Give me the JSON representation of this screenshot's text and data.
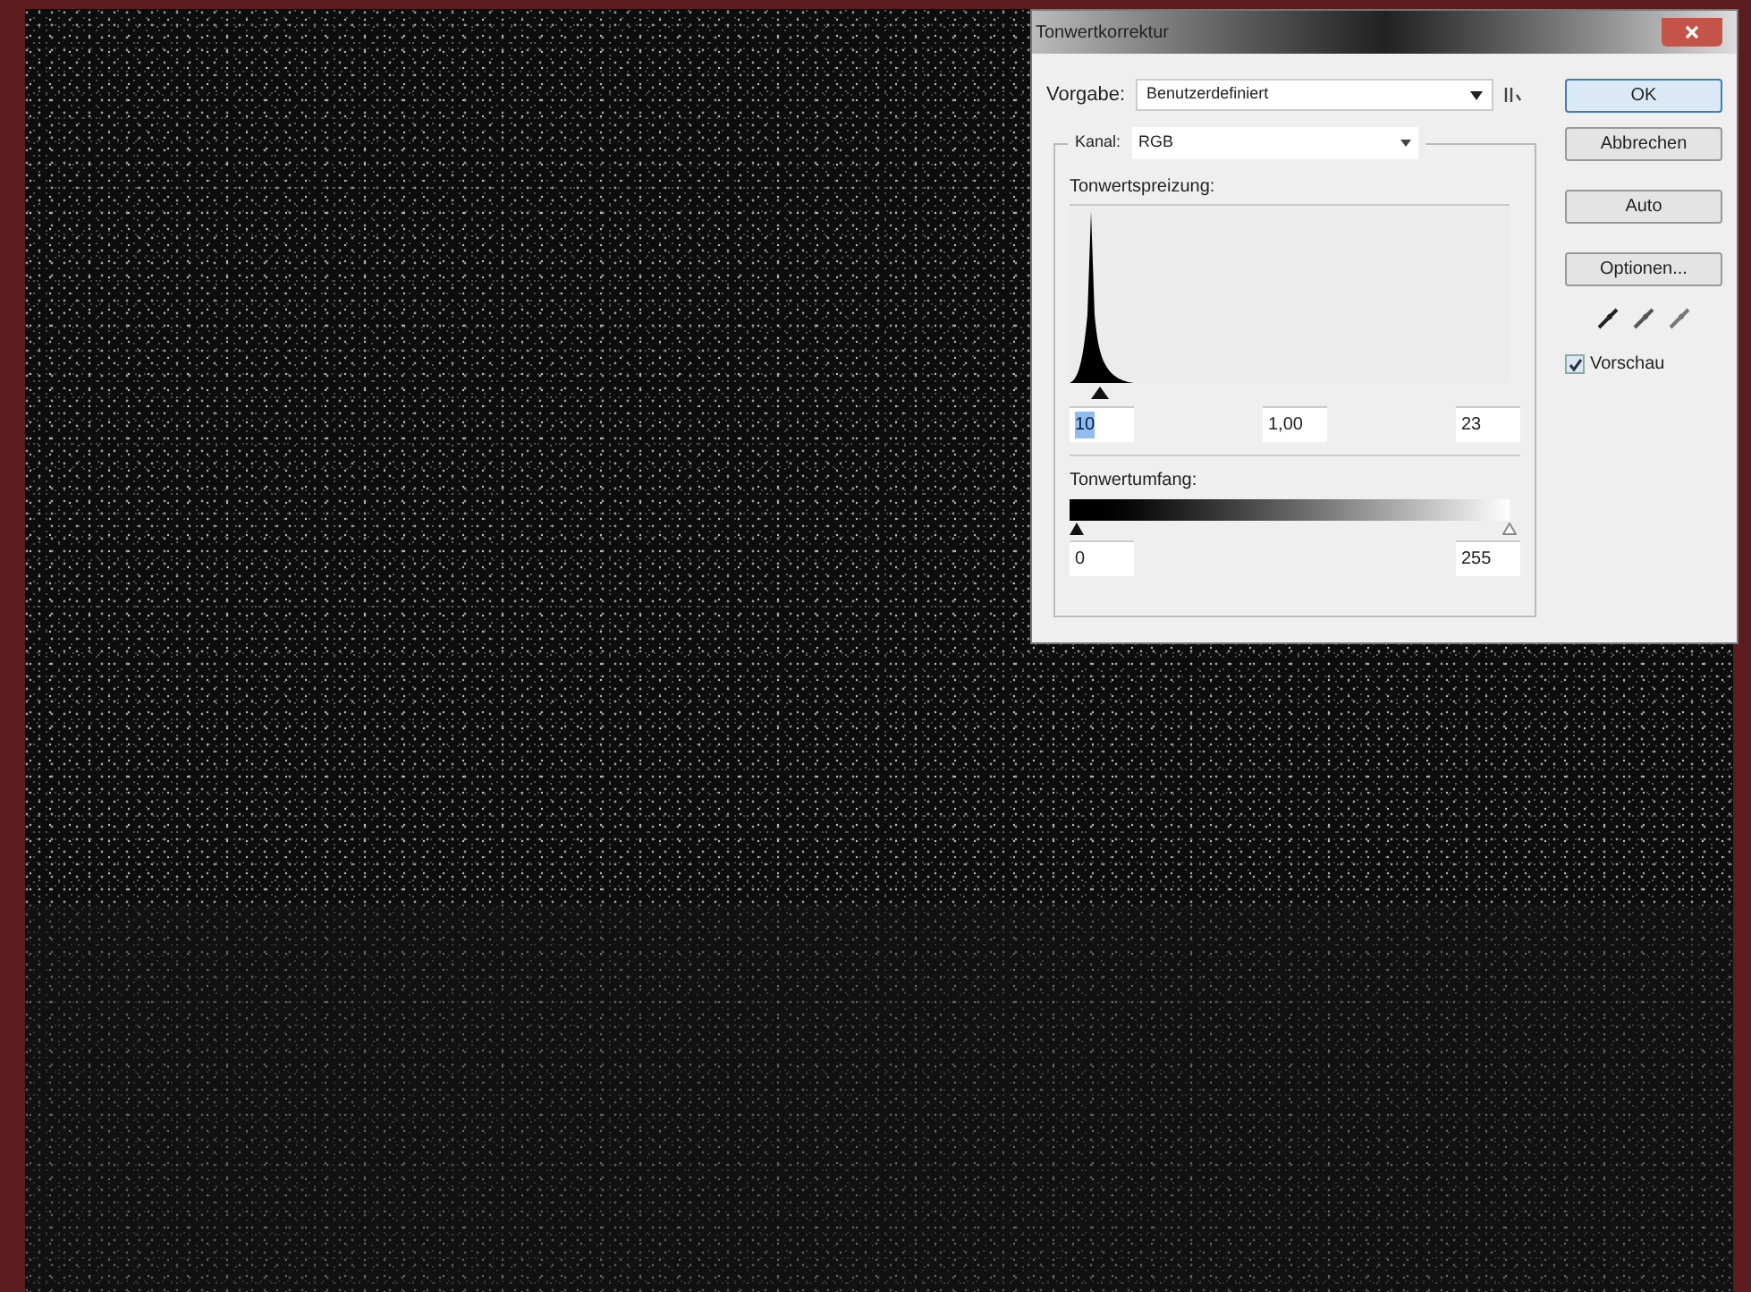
{
  "window": {
    "title": "Tonwertkorrektur"
  },
  "preset": {
    "label": "Vorgabe:",
    "value": "Benutzerdefiniert"
  },
  "channel": {
    "label": "Kanal:",
    "value": "RGB"
  },
  "input_levels": {
    "label": "Tonwertspreizung:",
    "fields": [
      {
        "value": "10",
        "text_selected": true
      },
      {
        "value": "1,00",
        "text_selected": false
      },
      {
        "value": "23",
        "text_selected": false
      }
    ]
  },
  "output_levels": {
    "label": "Tonwertumfang:",
    "fields": [
      {
        "value": "0",
        "text_selected": false
      },
      {
        "value": "255",
        "text_selected": false
      }
    ]
  },
  "buttons": [
    {
      "label": "OK",
      "selected": true
    },
    {
      "label": "Abbrechen",
      "selected": false
    },
    {
      "label": "Auto",
      "selected": false
    },
    {
      "label": "Optionen...",
      "selected": false
    }
  ],
  "preview": {
    "label": "Vorschau",
    "checked": true
  }
}
